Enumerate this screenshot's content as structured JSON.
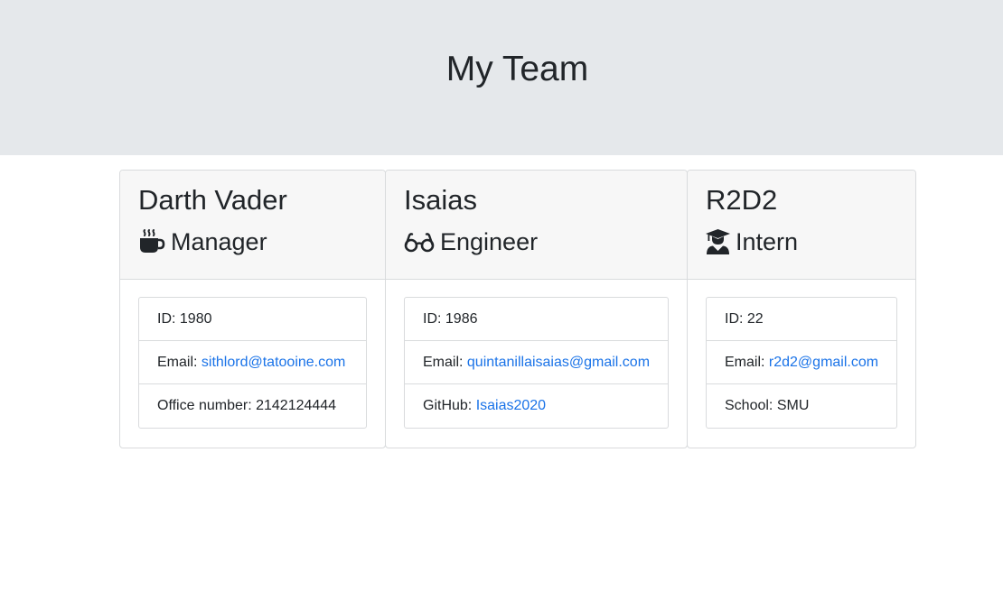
{
  "header": {
    "title": "My Team"
  },
  "employees": [
    {
      "name": "Darth Vader",
      "role": "Manager",
      "icon": "coffee-icon",
      "details": [
        {
          "label": "ID: ",
          "value": "1980",
          "link": false
        },
        {
          "label": "Email: ",
          "value": "sithlord@tatooine.com",
          "link": true
        },
        {
          "label": "Office number: ",
          "value": "2142124444",
          "link": false
        }
      ]
    },
    {
      "name": "Isaias",
      "role": "Engineer",
      "icon": "glasses-icon",
      "details": [
        {
          "label": "ID: ",
          "value": "1986",
          "link": false
        },
        {
          "label": "Email: ",
          "value": "quintanillaisaias@gmail.com",
          "link": true
        },
        {
          "label": "GitHub: ",
          "value": "Isaias2020",
          "link": true
        }
      ]
    },
    {
      "name": "R2D2",
      "role": "Intern",
      "icon": "graduate-icon",
      "details": [
        {
          "label": "ID: ",
          "value": "22",
          "link": false
        },
        {
          "label": "Email: ",
          "value": "r2d2@gmail.com",
          "link": true
        },
        {
          "label": "School: ",
          "value": "SMU",
          "link": false
        }
      ]
    }
  ],
  "colors": {
    "jumbotron": "#e5e8eb",
    "link": "#1a73e8",
    "card_header": "#f7f7f7"
  }
}
